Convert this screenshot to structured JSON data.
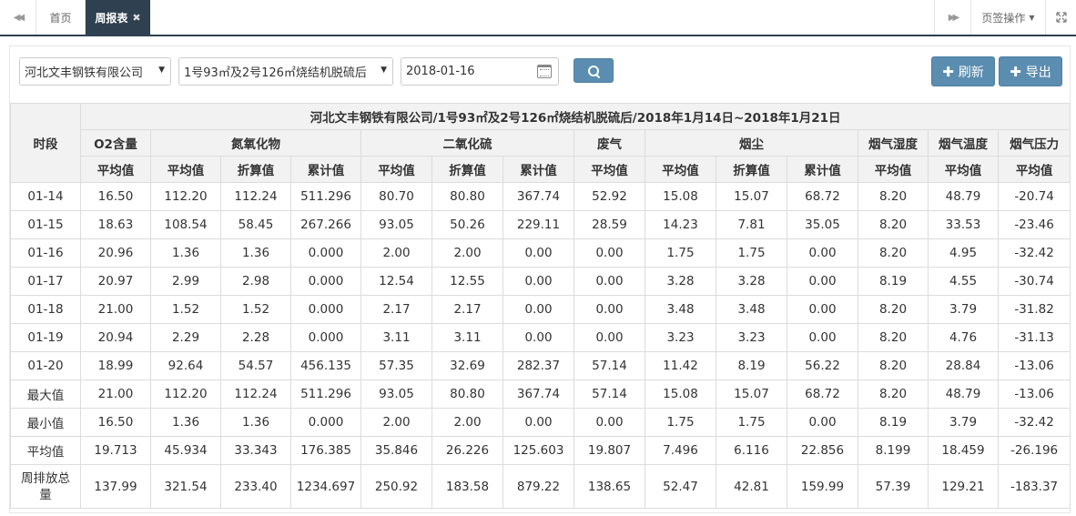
{
  "tabs": {
    "home": "首页",
    "active": "周报表",
    "ops": "页签操作"
  },
  "toolbar": {
    "company": "河北文丰钢铁有限公司",
    "equipment": "1号93㎡及2号126㎡烧结机脱硫后",
    "date": "2018-01-16",
    "refresh": "刷新",
    "export": "导出"
  },
  "table": {
    "title": "河北文丰钢铁有限公司/1号93㎡及2号126㎡烧结机脱硫后/2018年1月14日~2018年1月21日",
    "period_header": "时段",
    "groups": [
      "O2含量",
      "氮氧化物",
      "二氧化硫",
      "废气",
      "烟尘",
      "烟气湿度",
      "烟气温度",
      "烟气压力"
    ],
    "subheaders": [
      "平均值",
      "平均值",
      "折算值",
      "累计值",
      "平均值",
      "折算值",
      "累计值",
      "平均值",
      "平均值",
      "折算值",
      "累计值",
      "平均值",
      "平均值",
      "平均值"
    ],
    "rows": [
      [
        "01-14",
        "16.50",
        "112.20",
        "112.24",
        "511.296",
        "80.70",
        "80.80",
        "367.74",
        "52.92",
        "15.08",
        "15.07",
        "68.72",
        "8.20",
        "48.79",
        "-20.74"
      ],
      [
        "01-15",
        "18.63",
        "108.54",
        "58.45",
        "267.266",
        "93.05",
        "50.26",
        "229.11",
        "28.59",
        "14.23",
        "7.81",
        "35.05",
        "8.20",
        "33.53",
        "-23.46"
      ],
      [
        "01-16",
        "20.96",
        "1.36",
        "1.36",
        "0.000",
        "2.00",
        "2.00",
        "0.00",
        "0.00",
        "1.75",
        "1.75",
        "0.00",
        "8.20",
        "4.95",
        "-32.42"
      ],
      [
        "01-17",
        "20.97",
        "2.99",
        "2.98",
        "0.000",
        "12.54",
        "12.55",
        "0.00",
        "0.00",
        "3.28",
        "3.28",
        "0.00",
        "8.19",
        "4.55",
        "-30.74"
      ],
      [
        "01-18",
        "21.00",
        "1.52",
        "1.52",
        "0.000",
        "2.17",
        "2.17",
        "0.00",
        "0.00",
        "3.48",
        "3.48",
        "0.00",
        "8.20",
        "3.79",
        "-31.82"
      ],
      [
        "01-19",
        "20.94",
        "2.29",
        "2.28",
        "0.000",
        "3.11",
        "3.11",
        "0.00",
        "0.00",
        "3.23",
        "3.23",
        "0.00",
        "8.20",
        "4.76",
        "-31.13"
      ],
      [
        "01-20",
        "18.99",
        "92.64",
        "54.57",
        "456.135",
        "57.35",
        "32.69",
        "282.37",
        "57.14",
        "11.42",
        "8.19",
        "56.22",
        "8.20",
        "28.84",
        "-13.06"
      ],
      [
        "最大值",
        "21.00",
        "112.20",
        "112.24",
        "511.296",
        "93.05",
        "80.80",
        "367.74",
        "57.14",
        "15.08",
        "15.07",
        "68.72",
        "8.20",
        "48.79",
        "-13.06"
      ],
      [
        "最小值",
        "16.50",
        "1.36",
        "1.36",
        "0.000",
        "2.00",
        "2.00",
        "0.00",
        "0.00",
        "1.75",
        "1.75",
        "0.00",
        "8.19",
        "3.79",
        "-32.42"
      ],
      [
        "平均值",
        "19.713",
        "45.934",
        "33.343",
        "176.385",
        "35.846",
        "26.226",
        "125.603",
        "19.807",
        "7.496",
        "6.116",
        "22.856",
        "8.199",
        "18.459",
        "-26.196"
      ],
      [
        "周排放总量",
        "137.99",
        "321.54",
        "233.40",
        "1234.697",
        "250.92",
        "183.58",
        "879.22",
        "138.65",
        "52.47",
        "42.81",
        "159.99",
        "57.39",
        "129.21",
        "-183.37"
      ]
    ]
  }
}
